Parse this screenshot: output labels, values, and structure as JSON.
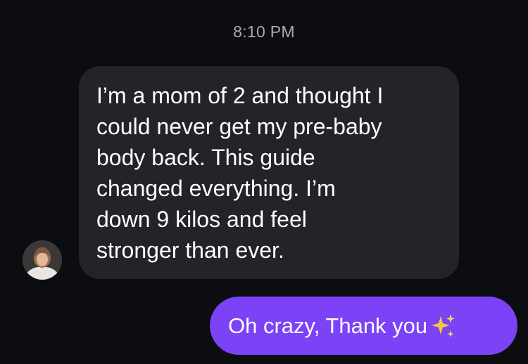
{
  "thread": {
    "timestamp": "8:10 PM"
  },
  "incoming_message": {
    "sender_avatar_icon": "profile-photo",
    "text": "I’m a mom of 2 and thought I\ncould never get my pre-baby\nbody back. This guide\nchanged everything. I’m\ndown 9 kilos and feel\nstronger than ever."
  },
  "outgoing_message": {
    "text": "Oh crazy, Thank you",
    "emoji_icon": "sparkles-icon"
  },
  "colors": {
    "background": "#0c0d10",
    "incoming_bubble": "#232428",
    "outgoing_bubble": "#7b42f6",
    "timestamp_text": "#a9abb2",
    "sparkles": "#f5c542"
  }
}
